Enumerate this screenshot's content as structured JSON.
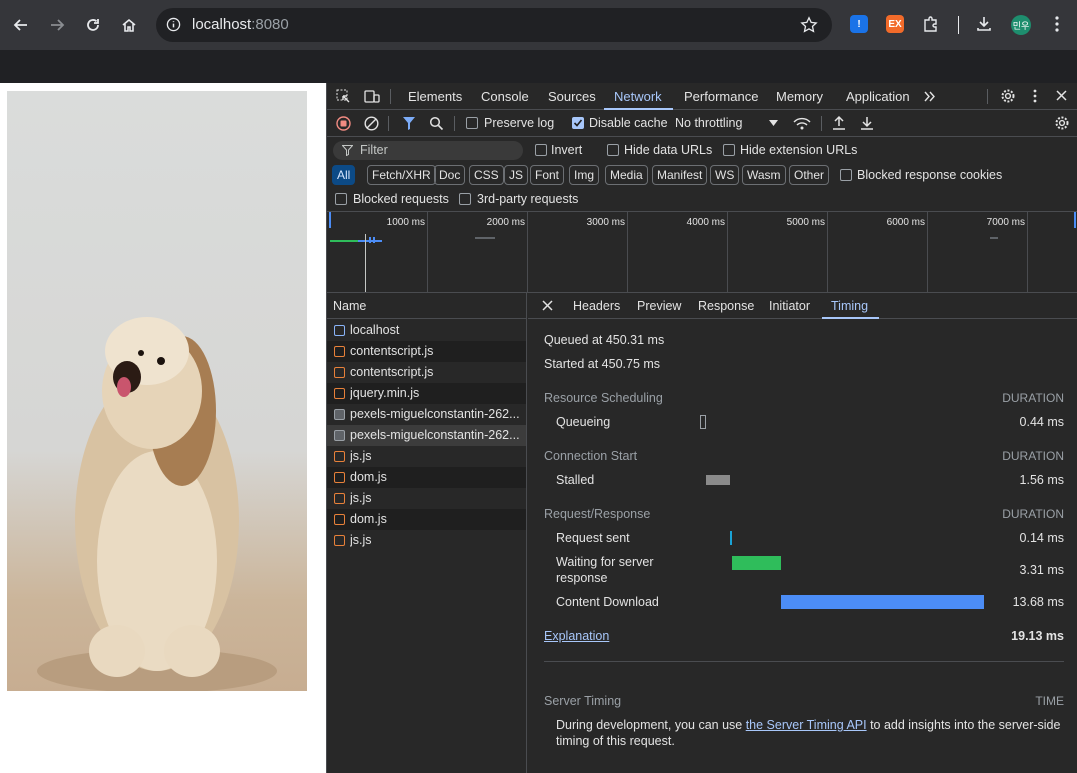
{
  "browser": {
    "url_host": "localhost",
    "url_port": ":8080",
    "profile_initial": "민우",
    "ext1_label": "!",
    "ext2_label": "EX"
  },
  "devtools": {
    "tabs": [
      "Elements",
      "Console",
      "Sources",
      "Network",
      "Performance",
      "Memory",
      "Application"
    ],
    "active_tab": "Network",
    "toolbar": {
      "preserve_log": "Preserve log",
      "disable_cache": "Disable cache",
      "throttling": "No throttling"
    },
    "filter": {
      "placeholder": "Filter",
      "invert": "Invert",
      "hide_data_urls": "Hide data URLs",
      "hide_extension_urls": "Hide extension URLs",
      "types": [
        "All",
        "Fetch/XHR",
        "Doc",
        "CSS",
        "JS",
        "Font",
        "Img",
        "Media",
        "Manifest",
        "WS",
        "Wasm",
        "Other"
      ],
      "blocked_response_cookies": "Blocked response cookies",
      "blocked_requests": "Blocked requests",
      "third_party": "3rd-party requests"
    },
    "overview_ticks": [
      "1000 ms",
      "2000 ms",
      "3000 ms",
      "4000 ms",
      "5000 ms",
      "6000 ms",
      "7000 ms"
    ],
    "request_list": {
      "header": "Name",
      "items": [
        {
          "name": "localhost",
          "kind": "doc"
        },
        {
          "name": "contentscript.js",
          "kind": "js"
        },
        {
          "name": "contentscript.js",
          "kind": "js"
        },
        {
          "name": "jquery.min.js",
          "kind": "js"
        },
        {
          "name": "pexels-miguelconstantin-262...",
          "kind": "img"
        },
        {
          "name": "pexels-miguelconstantin-262...",
          "kind": "img"
        },
        {
          "name": "js.js",
          "kind": "js"
        },
        {
          "name": "dom.js",
          "kind": "js"
        },
        {
          "name": "js.js",
          "kind": "js"
        },
        {
          "name": "dom.js",
          "kind": "js"
        },
        {
          "name": "js.js",
          "kind": "js"
        }
      ]
    },
    "detail_tabs": [
      "Headers",
      "Preview",
      "Response",
      "Initiator",
      "Timing"
    ],
    "active_detail_tab": "Timing",
    "timing": {
      "queued_at": "Queued at 450.31 ms",
      "started_at": "Started at 450.75 ms",
      "duration_label": "DURATION",
      "resource_scheduling": "Resource Scheduling",
      "queueing": "Queueing",
      "queueing_val": "0.44 ms",
      "connection_start": "Connection Start",
      "stalled": "Stalled",
      "stalled_val": "1.56 ms",
      "request_response": "Request/Response",
      "request_sent": "Request sent",
      "request_sent_val": "0.14 ms",
      "waiting_line1": "Waiting for server",
      "waiting_line2": "response",
      "waiting_val": "3.31 ms",
      "content_download": "Content Download",
      "content_download_val": "13.68 ms",
      "explanation": "Explanation",
      "total": "19.13 ms",
      "server_timing": "Server Timing",
      "time_label": "TIME",
      "server_note_pre": "During development, you can use ",
      "server_note_link": "the Server Timing API",
      "server_note_post": " to add insights into the server-side",
      "server_note_line2": "timing of this request."
    },
    "colors": {
      "stalled": "#8a8a8a",
      "request_sent": "#1aa3d6",
      "waiting": "#2fbd5b",
      "download": "#4c8df6"
    }
  }
}
